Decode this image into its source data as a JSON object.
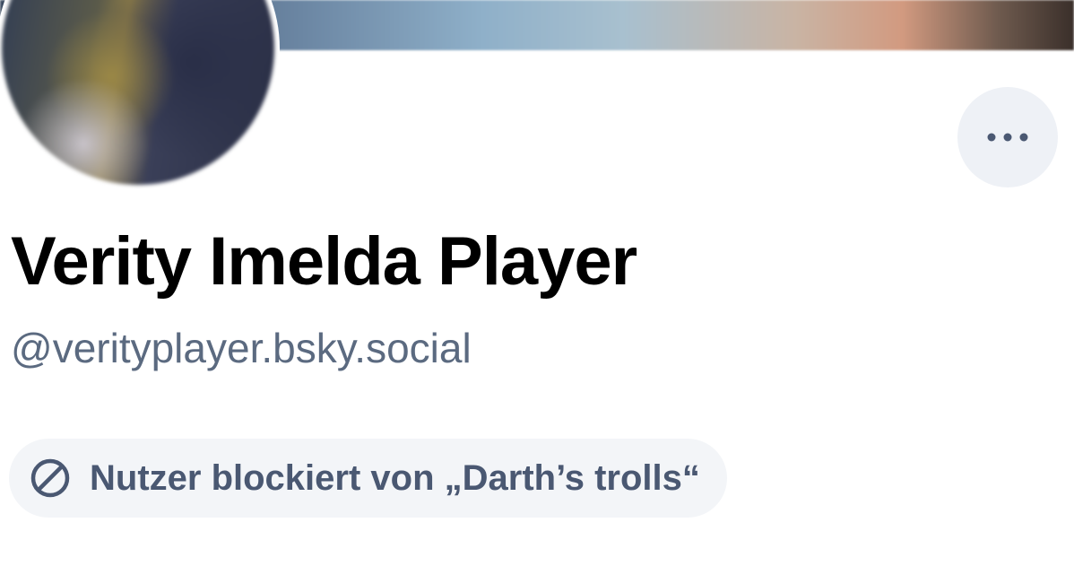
{
  "profile": {
    "display_name": "Verity Imelda Player",
    "handle": "@verityplayer.bsky.social",
    "block_notice": "Nutzer blockiert von „Darth’s trolls“"
  },
  "icons": {
    "more": "ellipsis-icon",
    "block": "block-icon"
  },
  "colors": {
    "handle": "#5b6a80",
    "pill_background": "#f3f5f8",
    "pill_text": "#4a5872",
    "more_button_background": "#eef1f6"
  }
}
